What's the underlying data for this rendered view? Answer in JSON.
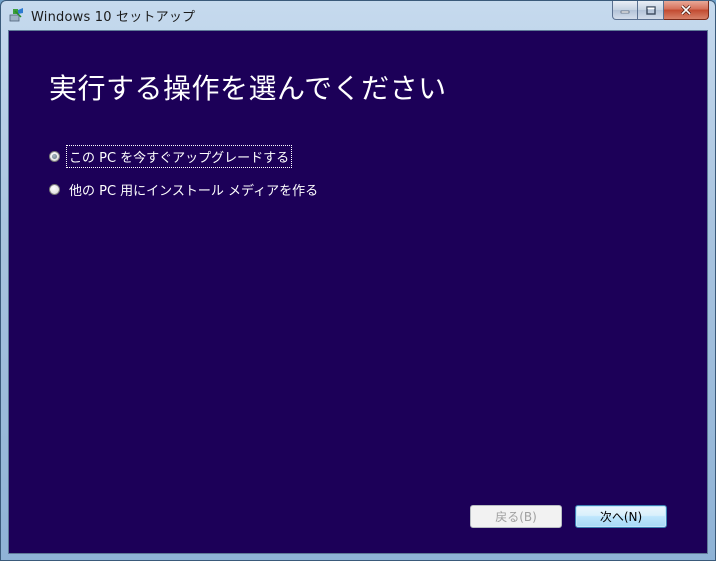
{
  "window": {
    "title": "Windows 10 セットアップ",
    "app_icon": "windows-setup-icon",
    "caption_buttons": {
      "minimize_icon": "minimize-icon",
      "maximize_icon": "maximize-icon",
      "close_icon": "close-icon"
    }
  },
  "main": {
    "heading": "実行する操作を選んでください",
    "options": [
      {
        "label": "この PC を今すぐアップグレードする",
        "selected": true
      },
      {
        "label": "他の PC 用にインストール メディアを作る",
        "selected": false
      }
    ]
  },
  "footer": {
    "back_label": "戻る(B)",
    "back_enabled": false,
    "next_label": "次へ(N)"
  },
  "colors": {
    "background": "#1c0058",
    "text": "#ffffff",
    "disabled_text": "#a0a0a0"
  }
}
